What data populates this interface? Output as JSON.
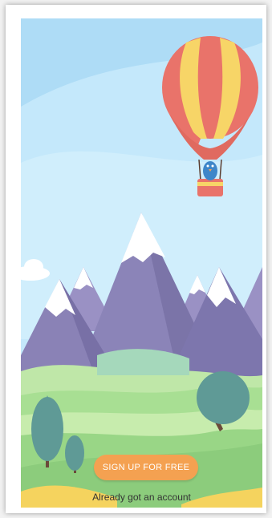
{
  "onboarding": {
    "signup_label": "SIGN UP FOR FREE",
    "login_label": "Already got an account"
  },
  "illustration": {
    "subject": "hot-air-balloon-over-mountains",
    "icons": [
      "hot-air-balloon-icon",
      "bird-passenger-icon",
      "cloud-icon",
      "mountain-icon",
      "tree-icon"
    ]
  },
  "colors": {
    "sky": "#bfe6fb",
    "balloon_red": "#e9736a",
    "balloon_yellow": "#f7d567",
    "mountain": "#8e86b8",
    "grass": "#9fdc8f",
    "button": "#f4a151"
  }
}
